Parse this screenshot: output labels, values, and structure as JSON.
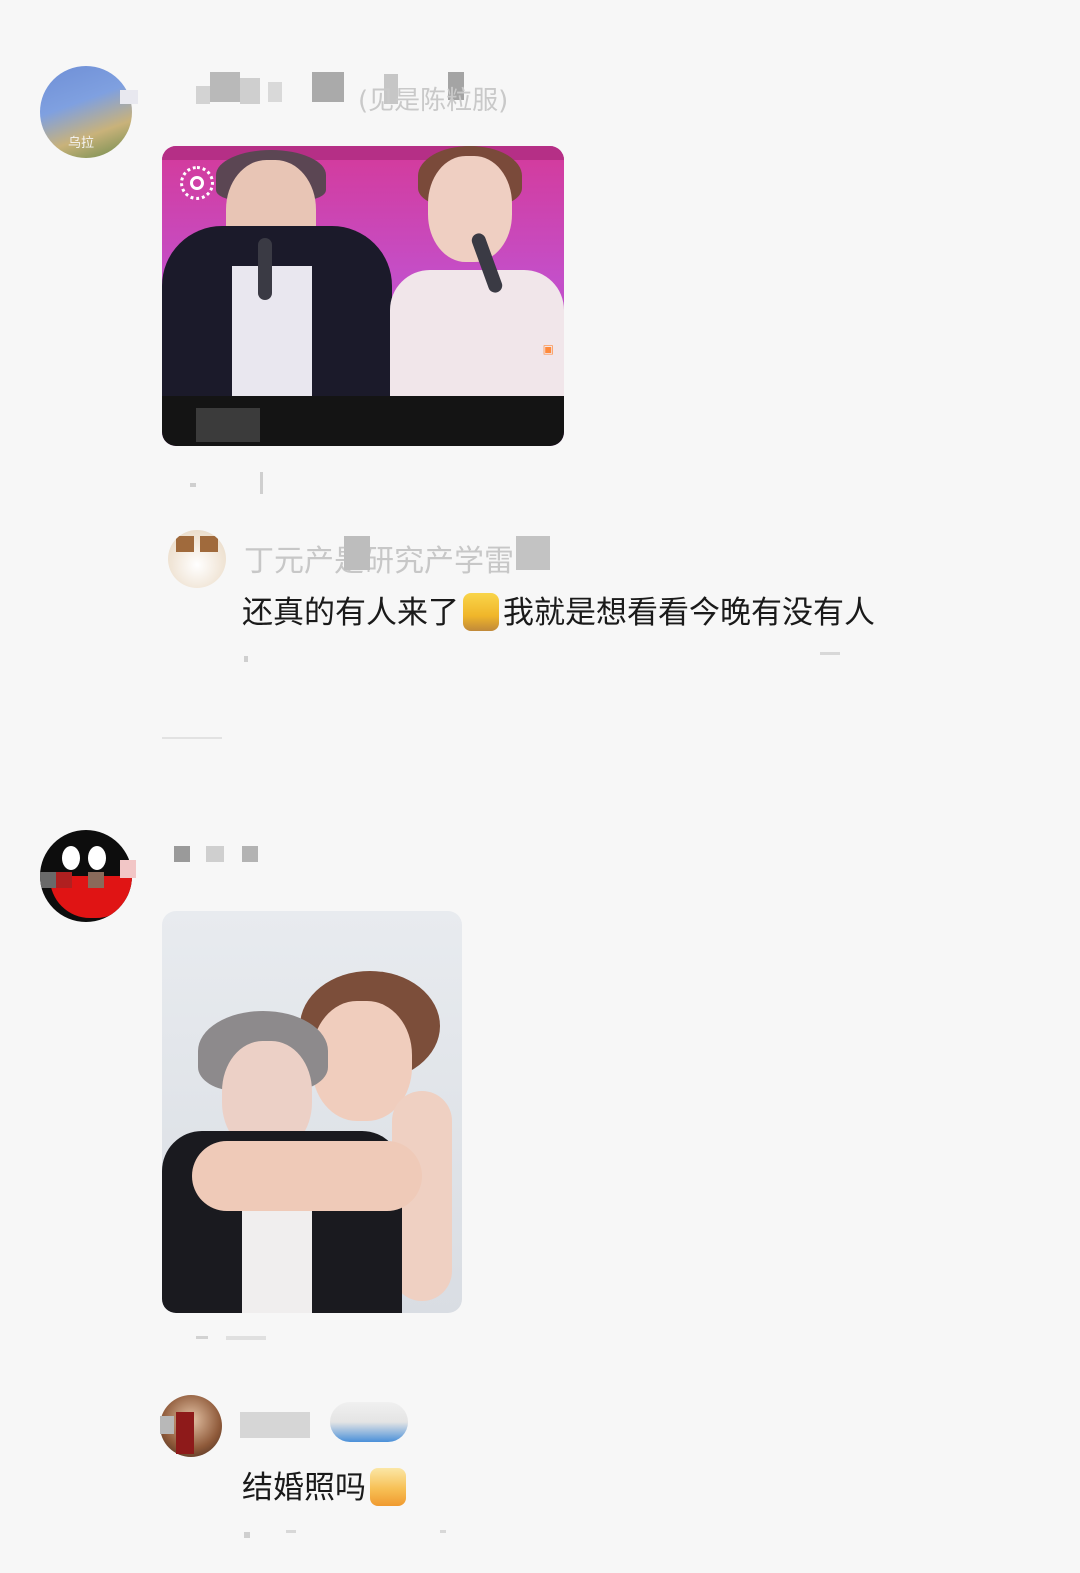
{
  "post1": {
    "avatar_caption": "乌拉",
    "header_text": "(见是陈粒服)"
  },
  "reply1": {
    "username": "丁元产是研究产学雷",
    "comment": "还真的有人来了",
    "comment_tail": "我就是想看看今晚有没有人"
  },
  "reply2": {
    "comment": "结婚照吗"
  },
  "colors": {
    "background": "#f7f7f7",
    "text": "#1a1a1a"
  }
}
